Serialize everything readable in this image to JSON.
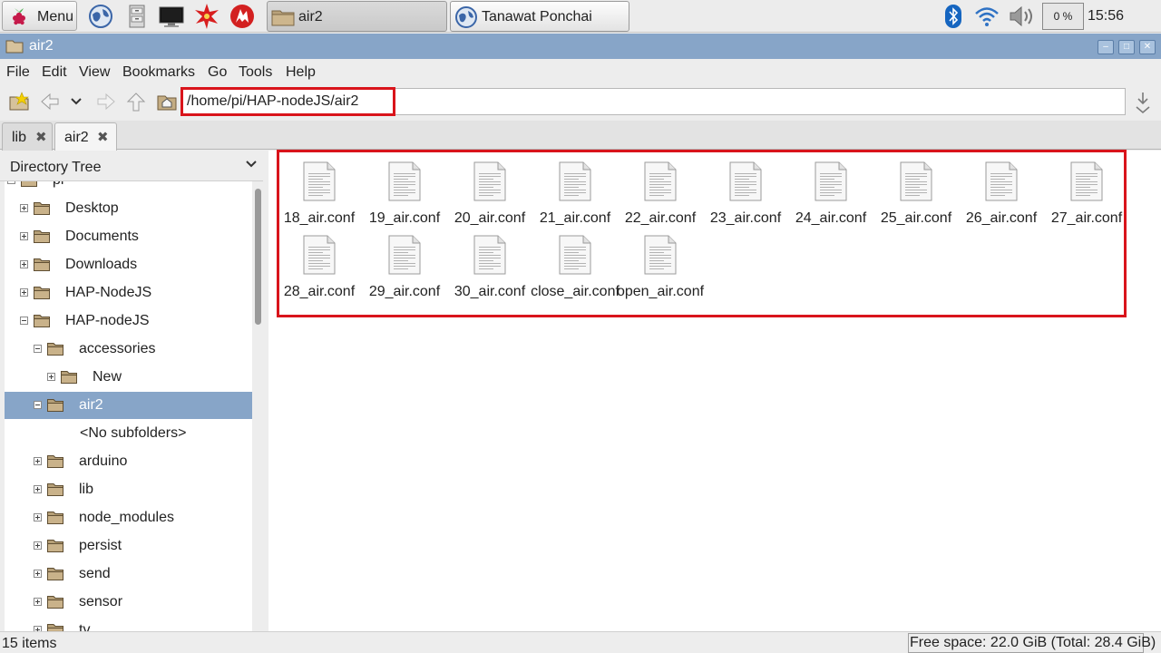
{
  "taskbar": {
    "menu_label": "Menu",
    "launchers": [
      "globe-icon",
      "file-cabinet-icon",
      "terminal-icon",
      "mathematica-icon",
      "wolfram-icon"
    ],
    "tasks": [
      {
        "label": "air2",
        "active": true
      },
      {
        "label": "Tanawat Ponchai",
        "active": false
      }
    ],
    "cpu": "0 %",
    "clock": "15:56"
  },
  "window": {
    "title": "air2",
    "accent": "#87a5c8"
  },
  "menubar": {
    "items": [
      "File",
      "Edit",
      "View",
      "Bookmarks",
      "Go",
      "Tools",
      "Help"
    ]
  },
  "toolbar": {
    "path": "/home/pi/HAP-nodeJS/air2"
  },
  "tabs": [
    {
      "label": "lib",
      "active": false
    },
    {
      "label": "air2",
      "active": true
    }
  ],
  "sidebar": {
    "header": "Directory Tree",
    "tree": [
      {
        "label": "pi",
        "level": 0,
        "expander": "minus"
      },
      {
        "label": "Desktop",
        "level": 1,
        "expander": "plus"
      },
      {
        "label": "Documents",
        "level": 1,
        "expander": "plus"
      },
      {
        "label": "Downloads",
        "level": 1,
        "expander": "plus"
      },
      {
        "label": "HAP-NodeJS",
        "level": 1,
        "expander": "plus"
      },
      {
        "label": "HAP-nodeJS",
        "level": 1,
        "expander": "minus"
      },
      {
        "label": "accessories",
        "level": 2,
        "expander": "minus"
      },
      {
        "label": "New",
        "level": 3,
        "expander": "plus"
      },
      {
        "label": "air2",
        "level": 2,
        "expander": "minus",
        "selected": true
      },
      {
        "label": "<No subfolders>",
        "level": 3,
        "expander": "none"
      },
      {
        "label": "arduino",
        "level": 2,
        "expander": "plus"
      },
      {
        "label": "lib",
        "level": 2,
        "expander": "plus"
      },
      {
        "label": "node_modules",
        "level": 2,
        "expander": "plus"
      },
      {
        "label": "persist",
        "level": 2,
        "expander": "plus"
      },
      {
        "label": "send",
        "level": 2,
        "expander": "plus"
      },
      {
        "label": "sensor",
        "level": 2,
        "expander": "plus"
      },
      {
        "label": "tv",
        "level": 2,
        "expander": "plus"
      }
    ]
  },
  "files": [
    "18_air.conf",
    "19_air.conf",
    "20_air.conf",
    "21_air.conf",
    "22_air.conf",
    "23_air.conf",
    "24_air.conf",
    "25_air.conf",
    "26_air.conf",
    "27_air.conf",
    "28_air.conf",
    "29_air.conf",
    "30_air.conf",
    "close_air.conf",
    "open_air.conf"
  ],
  "status": {
    "count": "15 items",
    "free_space": "Free space: 22.0 GiB (Total: 28.4 GiB)"
  },
  "highlight_color": "#d9141b"
}
